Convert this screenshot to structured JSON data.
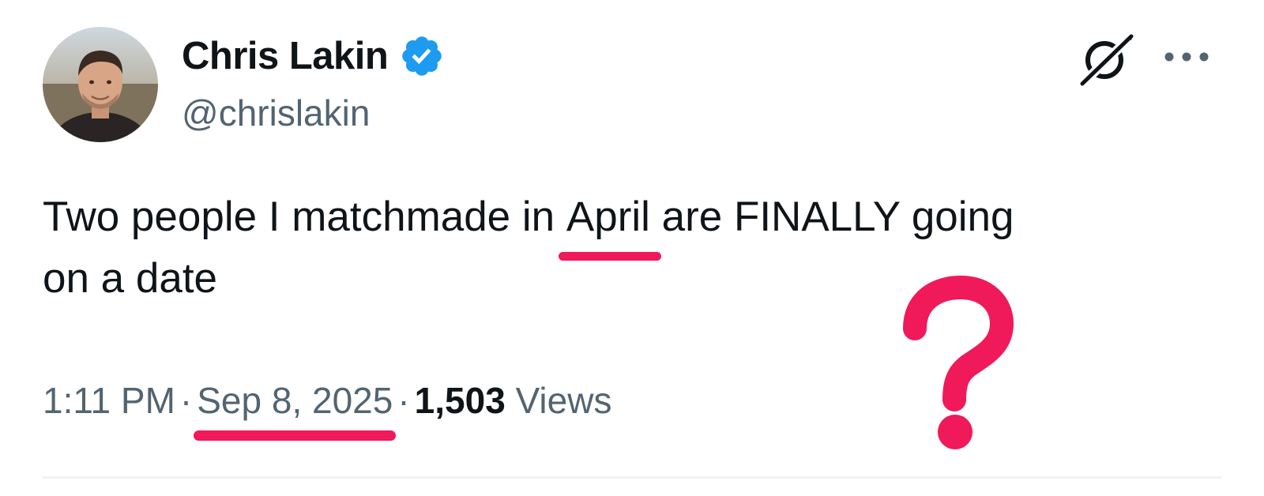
{
  "author": {
    "display_name": "Chris Lakin",
    "handle": "@chrislakin",
    "verified": true,
    "avatar_icon": "profile-photo"
  },
  "actions": {
    "grok_icon": "grok-icon",
    "more_icon": "more-options-icon"
  },
  "tweet": {
    "text_part1": "Two people I matchmade in ",
    "highlight_word": "April",
    "text_part2": " are FINALLY going",
    "text_line2": "on a date"
  },
  "meta": {
    "time": "1:11 PM",
    "separator": "·",
    "date": "Sep 8, 2025",
    "views_count": "1,503",
    "views_label": "Views"
  },
  "annotation": {
    "symbol": "?",
    "color": "#f0195a"
  },
  "colors": {
    "text_primary": "#0f1419",
    "text_secondary": "#536471",
    "verified_blue": "#1d9bf0",
    "highlight": "#f0195a",
    "divider": "#eff3f4"
  }
}
